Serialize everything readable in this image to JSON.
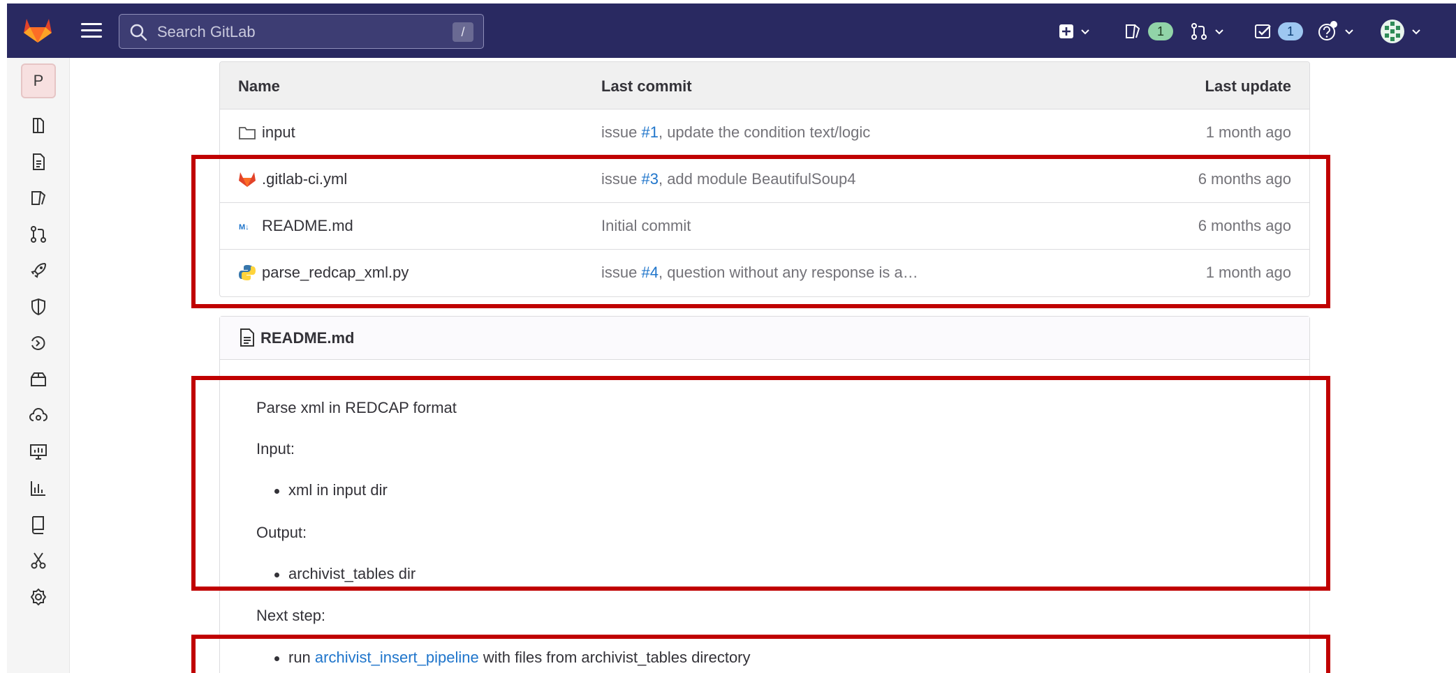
{
  "search": {
    "placeholder": "Search GitLab",
    "shortcut": "/"
  },
  "topbar": {
    "issues_count": "1",
    "todos_count": "1"
  },
  "sidebar": {
    "project_initial": "P"
  },
  "files": {
    "headers": {
      "name": "Name",
      "last_commit": "Last commit",
      "last_update": "Last update"
    },
    "rows": [
      {
        "name": "input",
        "icon": "folder-icon",
        "commit_prefix": "issue ",
        "commit_link": "#1",
        "commit_suffix": ", update the condition text/logic",
        "updated": "1 month ago"
      },
      {
        "name": ".gitlab-ci.yml",
        "icon": "gitlab-icon",
        "commit_prefix": "issue ",
        "commit_link": "#3",
        "commit_suffix": ", add module BeautifulSoup4",
        "updated": "6 months ago"
      },
      {
        "name": "README.md",
        "icon": "markdown-icon",
        "commit_prefix": "Initial commit",
        "commit_link": "",
        "commit_suffix": "",
        "updated": "6 months ago"
      },
      {
        "name": "parse_redcap_xml.py",
        "icon": "python-icon",
        "commit_prefix": "issue ",
        "commit_link": "#4",
        "commit_suffix": ", question without any response is a…",
        "updated": "1 month ago"
      }
    ]
  },
  "readme": {
    "title": "README.md",
    "intro": "Parse xml in REDCAP format",
    "input_label": "Input:",
    "input_item": "xml in input dir",
    "output_label": "Output:",
    "output_item": "archivist_tables dir",
    "next_label": "Next step:",
    "next_prefix": "run ",
    "next_link": "archivist_insert_pipeline",
    "next_suffix": " with files from archivist_tables directory"
  },
  "colors": {
    "topbar": "#292961",
    "link": "#1f75cb",
    "highlight": "#c00000"
  }
}
